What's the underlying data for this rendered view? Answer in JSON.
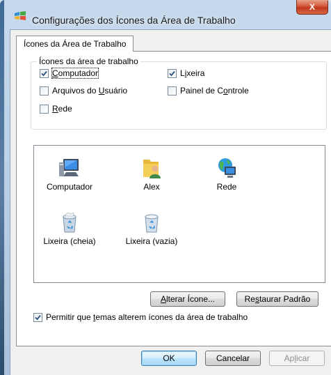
{
  "window": {
    "title": "Configurações dos Ícones da Área de Trabalho",
    "close_label": "X"
  },
  "tabs": [
    {
      "label": "Ícones da Área de Trabalho",
      "selected": true
    }
  ],
  "group": {
    "legend": "Ícones da área de trabalho",
    "checkboxes": [
      {
        "pre": "",
        "key": "C",
        "post": "omputador",
        "checked": true
      },
      {
        "pre": "L",
        "key": "i",
        "post": "xeira",
        "checked": true
      },
      {
        "pre": "Arquivos do ",
        "key": "U",
        "post": "suário",
        "checked": false
      },
      {
        "pre": "Painel de C",
        "key": "o",
        "post": "ntrole",
        "checked": false
      },
      {
        "pre": "",
        "key": "R",
        "post": "ede",
        "checked": false
      }
    ]
  },
  "icons": [
    {
      "label": "Computador",
      "icon": "computer-icon"
    },
    {
      "label": "Alex",
      "icon": "user-folder-icon"
    },
    {
      "label": "Rede",
      "icon": "network-globe-icon"
    },
    {
      "label": "Lixeira (cheia)",
      "icon": "recycle-bin-full-icon"
    },
    {
      "label": "Lixeira (vazia)",
      "icon": "recycle-bin-empty-icon"
    }
  ],
  "buttons": {
    "change_icon": {
      "key": "A",
      "post": "lterar Ícone..."
    },
    "restore_default": {
      "pre": "Re",
      "key": "s",
      "post": "taurar Padrão"
    },
    "ok": "OK",
    "cancel": "Cancelar",
    "apply": {
      "pre": "Ap",
      "key": "l",
      "post": "icar"
    }
  },
  "allow_themes": {
    "pre": "Permitir que ",
    "key": "t",
    "post": "emas alterem ícones da área de trabalho",
    "checked": true
  },
  "colors": {
    "accent_border": "#3c7fb1",
    "close_red": "#c0391c",
    "title_bar": "#b7cde3"
  }
}
